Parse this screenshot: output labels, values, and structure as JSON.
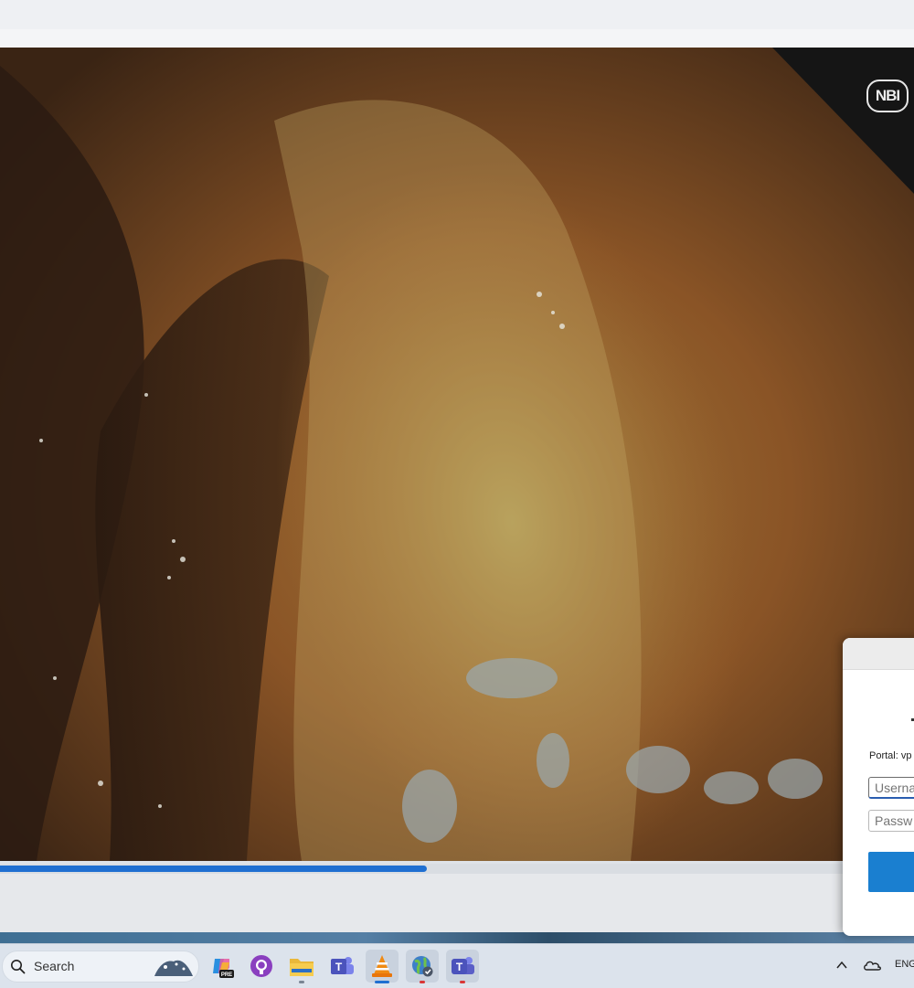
{
  "video": {
    "overlay_badge": "NBI",
    "progress_fraction": 0.467
  },
  "vpn_dialog": {
    "portal_label": "Portal: vp",
    "username_placeholder": "Userna",
    "password_placeholder": "Passw"
  },
  "taskbar": {
    "search_label": "Search",
    "apps": [
      "copilot-pre-icon",
      "github-desktop-icon",
      "file-explorer-icon",
      "teams-classic-icon",
      "vlc-icon",
      "vpn-globe-icon",
      "teams-icon"
    ],
    "tray_language": "ENG"
  },
  "colors": {
    "accent_blue": "#1f6fd1",
    "dialog_button": "#1a7fd0",
    "taskbar_bg": "#dce3ec"
  }
}
